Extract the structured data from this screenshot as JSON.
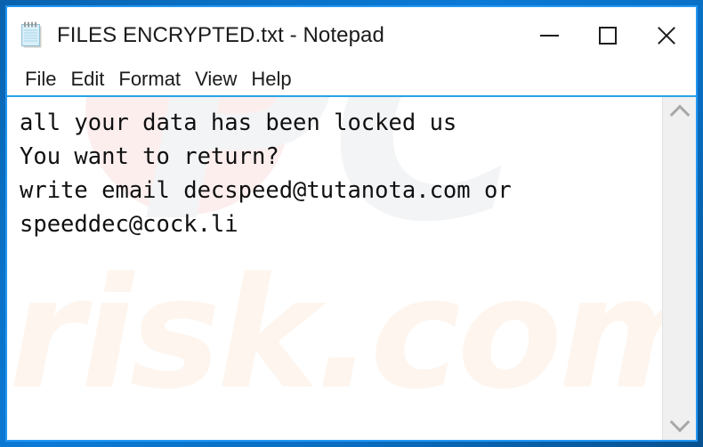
{
  "window": {
    "title": "FILES ENCRYPTED.txt - Notepad",
    "icon": "notepad-icon",
    "frame_color": "#0a6cbe",
    "accent_color": "#29a3e8",
    "controls": [
      {
        "name": "minimize",
        "glyph": "minimize-icon"
      },
      {
        "name": "maximize",
        "glyph": "maximize-icon"
      },
      {
        "name": "close",
        "glyph": "close-icon"
      }
    ]
  },
  "menu": {
    "items": [
      {
        "label": "File"
      },
      {
        "label": "Edit"
      },
      {
        "label": "Format"
      },
      {
        "label": "View"
      },
      {
        "label": "Help"
      }
    ]
  },
  "editor": {
    "lines": [
      "all your data has been locked us",
      "You want to return?",
      "write email decspeed@tutanota.com or",
      "speeddec@cock.li"
    ],
    "text_color": "#101010",
    "background": "#ffffff"
  },
  "scrollbar": {
    "up_arrow": "chevron-up-icon",
    "down_arrow": "chevron-down-icon",
    "track_color": "#f0f0f0"
  },
  "watermark": {
    "primary": "PC",
    "secondary": "risk.com",
    "primary_color": "#f3f4f6",
    "secondary_color": "#fdf5ee"
  }
}
